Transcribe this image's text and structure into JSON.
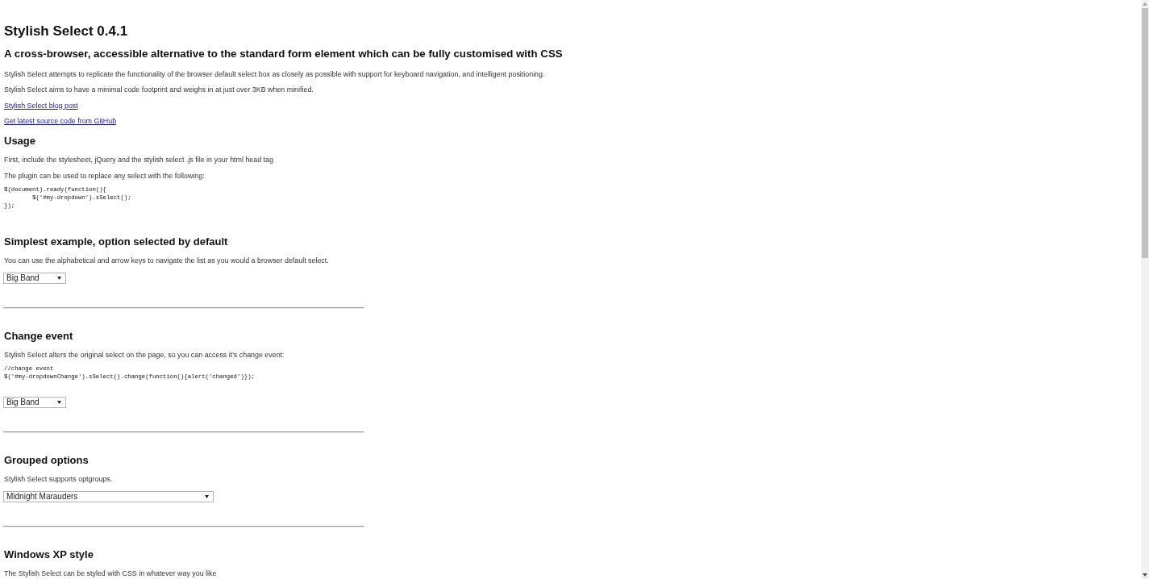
{
  "title": "Stylish Select 0.4.1",
  "subtitle": "A cross-browser, accessible alternative to the standard form element which can be fully customised with CSS",
  "intro": [
    {
      "kind": "text",
      "text": "Stylish Select attempts to replicate the functionality of the browser default select box as closely as possible with support for keyboard navigation, and intelligent positioning."
    },
    {
      "kind": "text",
      "text": "Stylish Select aims to have a minimal code footprint and weighs in at just over 3KB when minified."
    },
    {
      "kind": "link",
      "text": "Stylish Select blog post"
    },
    {
      "kind": "link",
      "text": "Get latest source code from GitHub"
    }
  ],
  "sections": [
    {
      "heading": "Usage",
      "blocks": [
        {
          "kind": "text",
          "text": "First, include the stylesheet, jQuery and the stylish select .js file in your html head tag"
        },
        {
          "kind": "text",
          "text": "The plugin can be used to replace any select with the following:"
        },
        {
          "kind": "code",
          "lines": [
            "$(document).ready(function(){",
            "        $('#my-dropdown').sSelect();",
            "});"
          ]
        }
      ]
    },
    {
      "heading": "Simplest example, option selected by default",
      "blocks": [
        {
          "kind": "text",
          "text": "You can use the alphabetical and arrow keys to navigate the list as you would a browser default select."
        },
        {
          "kind": "select",
          "value": "Big Band"
        },
        {
          "kind": "divider"
        }
      ]
    },
    {
      "heading": "Change event",
      "blocks": [
        {
          "kind": "text",
          "text": "Stylish Select alters the original select on the page, so you can access it's change event:"
        },
        {
          "kind": "code",
          "lines": [
            "//change event",
            "$('#my-dropdownChange').sSelect().change(function(){alert('changed')});"
          ]
        },
        {
          "kind": "select",
          "value": "Big Band"
        },
        {
          "kind": "divider"
        }
      ]
    },
    {
      "heading": "Grouped options",
      "blocks": [
        {
          "kind": "text",
          "text": "Stylish Select supports optgroups."
        },
        {
          "kind": "grouped_select",
          "value": "Midnight Marauders"
        },
        {
          "kind": "divider"
        }
      ]
    },
    {
      "heading": "Windows XP style",
      "blocks": [
        {
          "kind": "text",
          "text": "The Stylish Select can be styled with CSS in whatever way you like"
        }
      ]
    }
  ]
}
